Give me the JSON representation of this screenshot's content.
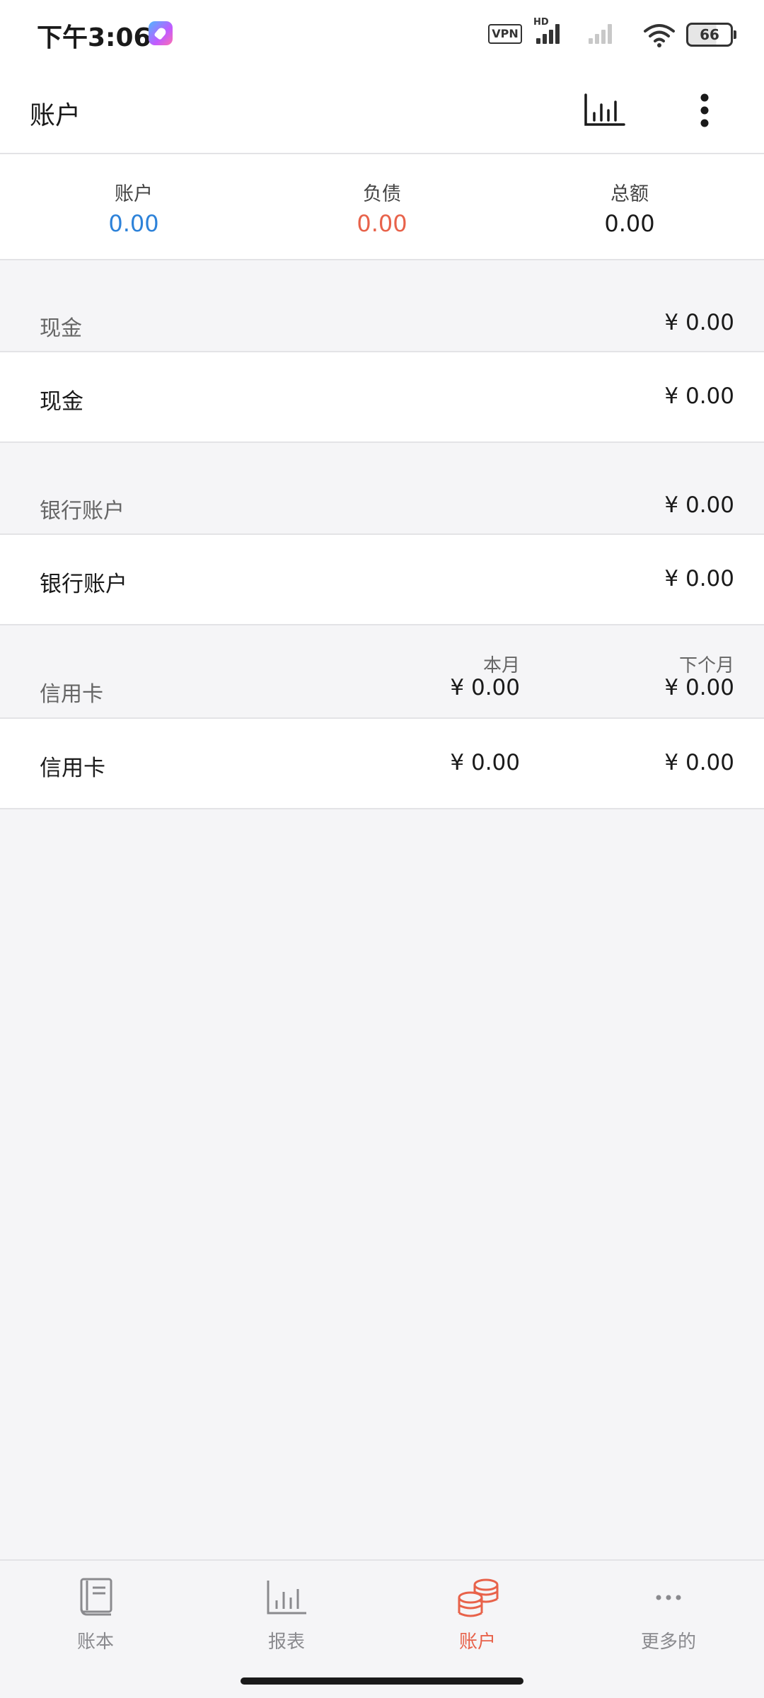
{
  "status_bar": {
    "time": "下午3:06",
    "vpn": "VPN",
    "hd": "HD",
    "battery": "66"
  },
  "app_bar": {
    "title": "账户"
  },
  "summary": {
    "accounts_label": "账户",
    "accounts_value": "0.00",
    "liabilities_label": "负债",
    "liabilities_value": "0.00",
    "total_label": "总额",
    "total_value": "0.00"
  },
  "sections": {
    "cash": {
      "header_label": "现金",
      "header_amount": "¥ 0.00",
      "row_label": "现金",
      "row_amount": "¥ 0.00"
    },
    "bank": {
      "header_label": "银行账户",
      "header_amount": "¥ 0.00",
      "row_label": "银行账户",
      "row_amount": "¥ 0.00"
    },
    "credit": {
      "header_label": "信用卡",
      "col_this_month": "本月",
      "col_next_month": "下个月",
      "header_this_month_amount": "¥ 0.00",
      "header_next_month_amount": "¥ 0.00",
      "row_label": "信用卡",
      "row_this_month_amount": "¥ 0.00",
      "row_next_month_amount": "¥ 0.00"
    }
  },
  "bottom_nav": {
    "items": [
      {
        "label": "账本",
        "icon": "book-icon"
      },
      {
        "label": "报表",
        "icon": "bar-chart-icon"
      },
      {
        "label": "账户",
        "icon": "coins-icon"
      },
      {
        "label": "更多的",
        "icon": "more-horizontal-icon"
      }
    ],
    "active_index": 2
  },
  "colors": {
    "accent": "#e8624a",
    "account_value": "#2d82d9",
    "liability_value": "#e8624a",
    "inactive": "#8a8a8e"
  }
}
